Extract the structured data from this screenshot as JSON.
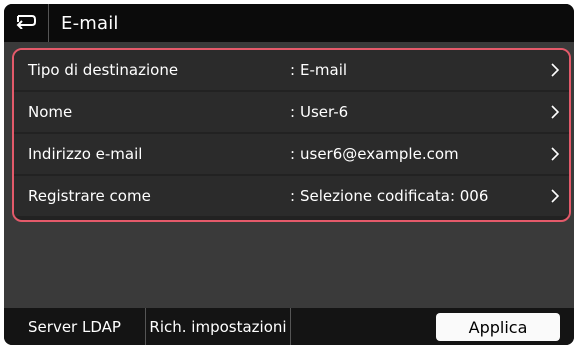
{
  "header": {
    "title": "E-mail",
    "back_icon": "back-arrow-icon"
  },
  "rows": [
    {
      "label": "Tipo di destinazione",
      "separator": ":",
      "value": "E-mail"
    },
    {
      "label": "Nome",
      "separator": ":",
      "value": "User-6"
    },
    {
      "label": "Indirizzo e-mail",
      "separator": ":",
      "value": "user6@example.com"
    },
    {
      "label": "Registrare come",
      "separator": ":",
      "value": "Selezione codificata: 006"
    }
  ],
  "footer": {
    "ldap_label": "Server LDAP",
    "settings_label": "Rich. impostazioni",
    "apply_label": "Applica"
  },
  "colors": {
    "highlight_border": "#e45a6a",
    "background": "#3a3a3a"
  }
}
